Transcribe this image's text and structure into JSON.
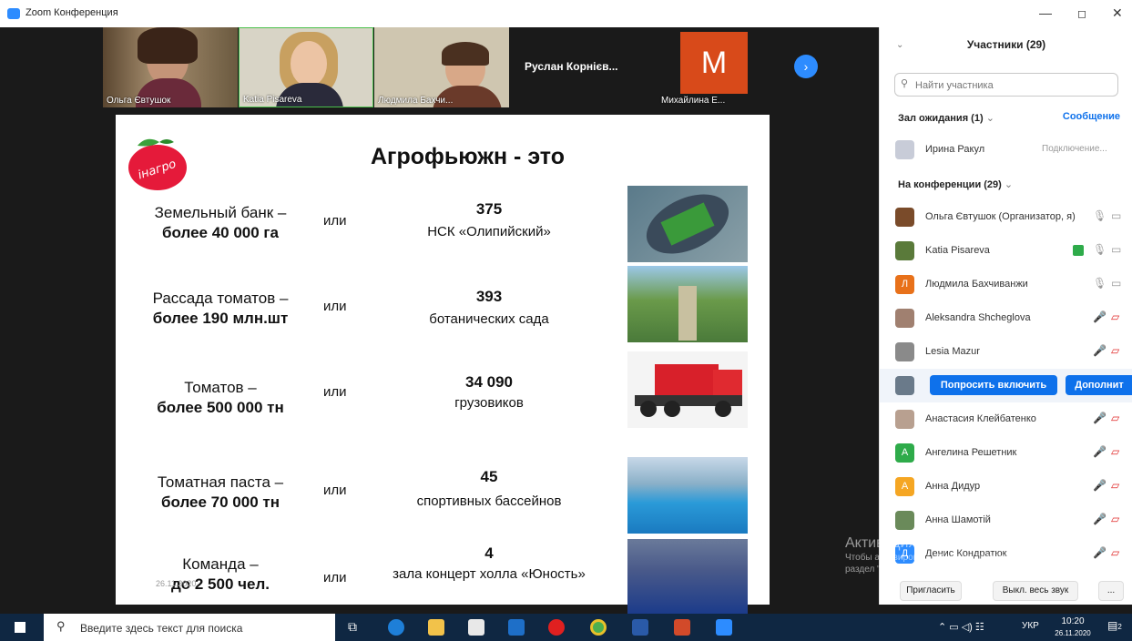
{
  "window": {
    "title": "Zoom Конференция",
    "minimize": "—",
    "maximize": "◻",
    "close": "✕"
  },
  "gallery": {
    "thumbs": [
      {
        "name": "Ольга Євтушок"
      },
      {
        "name": "Katia Pisareva"
      },
      {
        "name": "Людмила Бахчи..."
      },
      {
        "name": "Руслан  Корнієв..."
      },
      {
        "name": "Михайлина Е...",
        "initial": "M"
      }
    ],
    "next_arrow": "›"
  },
  "slide": {
    "title": "Агрофьюжн - это",
    "logo_text": "інагро",
    "rows": [
      {
        "l1": "Земельный банк –",
        "l2": "более 40 000 га",
        "or": "или",
        "num": "375",
        "desc": "НСК «Олипийский»"
      },
      {
        "l1": "Рассада томатов –",
        "l2": "более 190 млн.шт",
        "or": "или",
        "num": "393",
        "desc": "ботанических сада"
      },
      {
        "l1": "Томатов –",
        "l2": "более 500 000 тн",
        "or": "или",
        "num": "34 090",
        "desc": "грузовиков"
      },
      {
        "l1": "Томатная паста –",
        "l2": "более 70 000 тн",
        "or": "или",
        "num": "45",
        "desc": "спортивных бассейнов"
      },
      {
        "l1": "Команда –",
        "l2": "до 2 500 чел.",
        "or": "или",
        "num": "4",
        "desc": "зала концерт холла «Юность»"
      }
    ],
    "date": "26.11.2020"
  },
  "participants": {
    "title": "Участники (29)",
    "search_placeholder": "Найти участника",
    "waiting_label": "Зал ожидания (1)",
    "message_link": "Сообщение",
    "waiting_person": {
      "name": "Ирина Ракул",
      "status": "Подключение..."
    },
    "in_conf_label": "На конференции (29)",
    "list": [
      {
        "name": "Ольга Євтушок (Организатор, я)",
        "color": "#7a4b2a"
      },
      {
        "name": "Katia Pisareva",
        "color": "#5a7a3a"
      },
      {
        "name": "Людмила Бахчиванжи",
        "initial": "Л",
        "color": "#e8711a"
      },
      {
        "name": "Aleksandra Shcheglova",
        "color": "#a08070"
      },
      {
        "name": "Lesia Mazur",
        "color": "#8a8a8a"
      },
      {
        "name": "",
        "color": "#6a7a8a"
      },
      {
        "name": "Анастасия Клейбатенко",
        "color": "#b8a090"
      },
      {
        "name": "Ангелина Решетник",
        "initial": "А",
        "color": "#2eab4a"
      },
      {
        "name": "Анна Дидур",
        "initial": "А",
        "color": "#f5a623"
      },
      {
        "name": "Анна Шамотій",
        "color": "#6a8a5a"
      },
      {
        "name": "Денис Кондратюк",
        "initial": "Д",
        "color": "#2d8cff"
      }
    ],
    "ask_button": "Попросить включить",
    "more_button": "Дополнит",
    "invite_button": "Пригласить",
    "mute_all_button": "Выкл. весь звук",
    "more_dots": "..."
  },
  "watermark": {
    "line1": "Активация Windows",
    "line2": "Чтобы активировать Windows, перейдите в",
    "line3": "раздел \"Параметры\"."
  },
  "taskbar": {
    "search_text": "Введите здесь текст для поиска",
    "lang": "УКР",
    "time": "10:20",
    "date": "26.11.2020",
    "notif_count": "2"
  }
}
